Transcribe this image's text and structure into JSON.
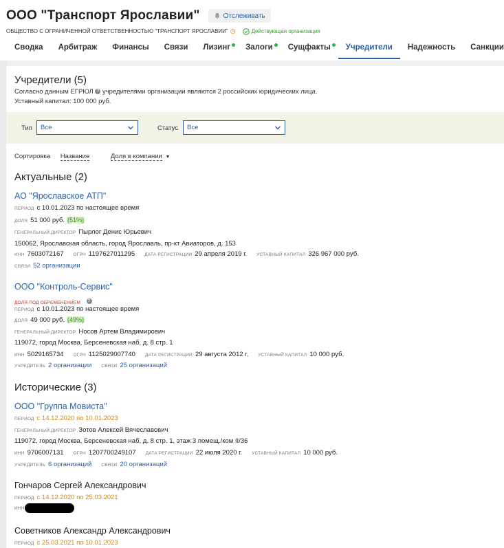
{
  "header": {
    "title": "ООО \"Транспорт Ярославии\"",
    "follow_label": "Отслеживать",
    "full_name": "ОБЩЕСТВО С ОГРАНИЧЕННОЙ ОТВЕТСТВЕННОСТЬЮ \"ТРАНСПОРТ ЯРОСЛАВИИ\"",
    "status": "Действующая организация"
  },
  "tabs": [
    {
      "label": "Сводка",
      "dot": false
    },
    {
      "label": "Арбитраж",
      "dot": false
    },
    {
      "label": "Финансы",
      "dot": false
    },
    {
      "label": "Связи",
      "dot": false
    },
    {
      "label": "Лизинг",
      "dot": true
    },
    {
      "label": "Залоги",
      "dot": true
    },
    {
      "label": "Сущфакты",
      "dot": true
    },
    {
      "label": "Учредители",
      "dot": false,
      "active": true
    },
    {
      "label": "Надежность",
      "dot": false
    },
    {
      "label": "Санкции",
      "dot": false
    }
  ],
  "section": {
    "title": "Учредители (5)",
    "line1_a": "Согласно данным ЕГРЮЛ",
    "line1_b": "учредителями организации являются 2 российских юридических лица.",
    "line2": "Уставный капитал: 100 000 руб."
  },
  "filters": {
    "type_label": "Тип",
    "type_value": "Все",
    "status_label": "Статус",
    "status_value": "Все"
  },
  "sort": {
    "label": "Сортировка",
    "by_name": "Название",
    "by_share": "Доля в компании"
  },
  "labels": {
    "period": "период",
    "share": "доля",
    "director": "генеральный директор",
    "inn": "ИНН",
    "ogrn": "ОГРН",
    "reg_date": "дата регистрации",
    "capital": "уставный капитал",
    "links": "связи",
    "founder": "учредитель",
    "encumbrance": "доля под обременением"
  },
  "actual": {
    "title": "Актуальные (2)",
    "items": [
      {
        "name": "АО \"Ярославское АТП\"",
        "period": "с 10.01.2023 по настоящее время",
        "share": "51 000 руб.",
        "share_pct": "(51%)",
        "director": "Пырлог Денис Юрьевич",
        "address": "150062, Ярославская область, город Ярославль, пр-кт Авиаторов, д. 153",
        "inn": "7603072167",
        "ogrn": "1197627011295",
        "reg_date": "29 апреля 2019 г.",
        "capital": "326 967 000 руб.",
        "links": "52 организации"
      },
      {
        "name": "ООО \"Контроль-Сервис\"",
        "period": "с 10.01.2023 по настоящее время",
        "share": "49 000 руб.",
        "share_pct": "(49%)",
        "director": "Носов Артем Владимирович",
        "address": "119072, город Москва, Берсеневская наб, д. 8 стр. 1",
        "inn": "5029165734",
        "ogrn": "1125029007740",
        "reg_date": "29 августа 2012 г.",
        "capital": "10 000 руб.",
        "founders": "2 организации",
        "links": "25 организаций"
      }
    ]
  },
  "historical": {
    "title": "Исторические (3)",
    "items": [
      {
        "name": "ООО \"Группа Мовиста\"",
        "period": "с 14.12.2020 по 10.01.2023",
        "director": "Зотов Алексей Вячеславович",
        "address": "119072, город Москва, Берсеневская наб, д. 8 стр. 1, этаж 3 помещ./ком II/36",
        "inn": "9706007131",
        "ogrn": "1207700249107",
        "reg_date": "22 июля 2020 г.",
        "capital": "10 000 руб.",
        "founders": "6 организаций",
        "links": "20 организаций"
      },
      {
        "name": "Гончаров Сергей Александрович",
        "period": "с 14.12.2020 по 25.03.2021"
      },
      {
        "name": "Советников Александр Александрович",
        "period": "с 25.03.2021 по 10.01.2023"
      }
    ]
  }
}
